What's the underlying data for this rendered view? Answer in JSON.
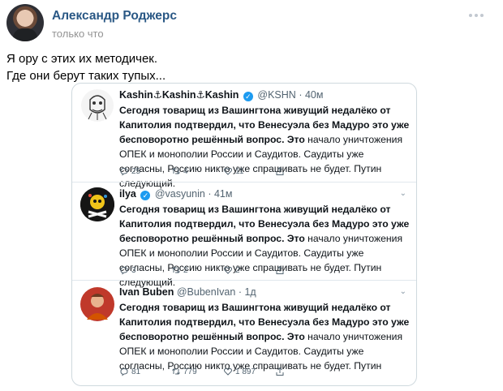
{
  "post": {
    "author": "Александр Роджерс",
    "time": "только что",
    "text_lines": [
      "Я ору с этих их методичек.",
      "Где они берут таких тупых..."
    ]
  },
  "tweets": [
    {
      "name": "Kashin⚓Kashin⚓Kashin",
      "handle": "@KSHN",
      "time": "· 40м",
      "verified": true,
      "bold": "Сегодня товарищ из Вашингтона живущий недалёко от Капитолия подтвердил, что  Венесуэла без Мадуро это уже бесповоротно решённый вопрос. Это",
      "normal": " начало уничтожения ОПЕК и монополии России и Саудитов. Саудиты уже согласны, Россию никто уже спрашивать не будет. Путин следующий.",
      "replies": "25",
      "retweets": "4",
      "likes": "11"
    },
    {
      "name": "ilya",
      "handle": "@vasyunin",
      "time": "· 41м",
      "verified": true,
      "bold": "Сегодня товарищ из Вашингтона живущий недалёко от Капитолия подтвердил, что  Венесуэла без Мадуро это уже бесповоротно решённый вопрос. Это",
      "normal": " начало уничтожения ОПЕК и монополии России и Саудитов. Саудиты уже согласны, Россию никто уже спрашивать не будет. Путин следующий.",
      "replies": "3",
      "retweets": "2",
      "likes": "2"
    },
    {
      "name": "Ivan Buben",
      "handle": "@BubenIvan",
      "time": "· 1д",
      "verified": false,
      "bold": "Сегодня товарищ из Вашингтона живущий недалёко от Капитолия подтвердил, что  Венесуэла без Мадуро это уже бесповоротно решённый вопрос. Это",
      "normal": " начало уничтожения ОПЕК и монополии России и Саудитов. Саудиты уже согласны, Россию никто уже спрашивать не будет. Путин",
      "replies": "81",
      "retweets": "779",
      "likes": "1 897"
    }
  ],
  "colors": {
    "author_link": "#2a5885",
    "muted": "#939393",
    "verified": "#1d9bf0",
    "tweet_text": "#0f1419",
    "tweet_meta": "#536471"
  },
  "icons": [
    "more-dots-icon",
    "verified-icon",
    "reply-icon",
    "retweet-icon",
    "like-icon",
    "share-icon",
    "chevron-down-icon"
  ]
}
